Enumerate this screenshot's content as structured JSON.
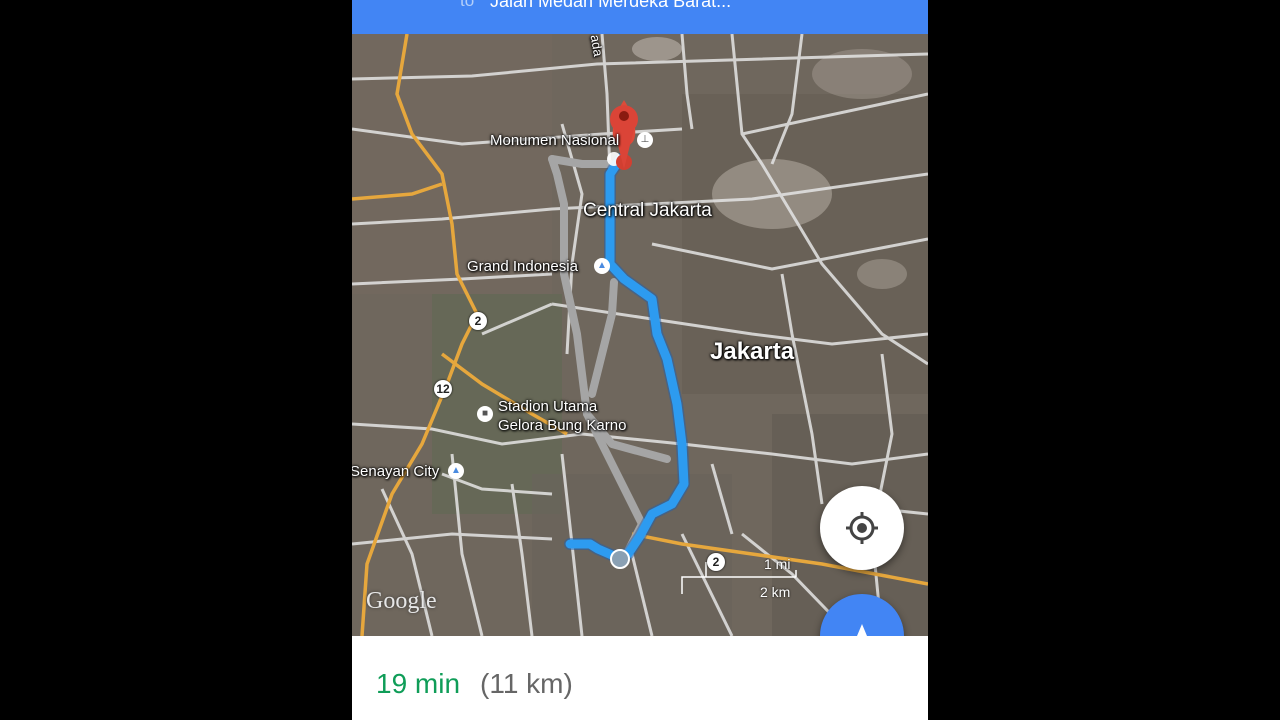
{
  "header": {
    "to_label": "to",
    "destination": "Jalan Medan Merdeka Barat..."
  },
  "map": {
    "labels": {
      "road_top": "ada",
      "monumen": "Monumen Nasional",
      "central_jakarta": "Central Jakarta",
      "grand_indonesia": "Grand Indonesia",
      "jakarta": "Jakarta",
      "stadion_line1": "Stadion Utama",
      "stadion_line2": "Gelora Bung Karno",
      "senayan_city": "Senayan City"
    },
    "road_shields": [
      "2",
      "12",
      "2"
    ],
    "scale": {
      "miles": "1 mi",
      "km": "2 km"
    },
    "attribution": "Google",
    "route_color": "#2d9bf0",
    "alt_route_color": "#a5a5a5"
  },
  "buttons": {
    "my_location_icon": "crosshair-icon",
    "navigate_icon": "navigation-arrow-icon"
  },
  "footer": {
    "duration": "19 min",
    "distance": "(11 km)"
  }
}
